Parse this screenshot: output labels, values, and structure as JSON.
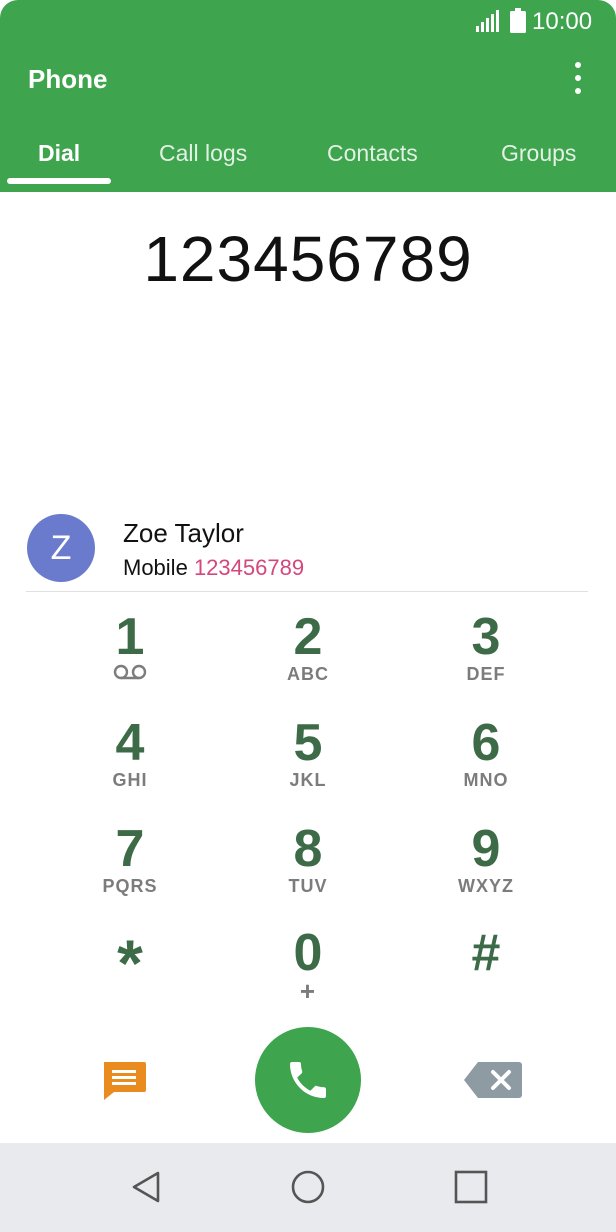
{
  "status_bar": {
    "time": "10:00",
    "signal_icon": "signal-icon",
    "battery_icon": "battery-icon"
  },
  "app": {
    "title": "Phone",
    "menu_icon": "overflow-menu-icon"
  },
  "tabs": [
    {
      "label": "Dial",
      "active": true
    },
    {
      "label": "Call logs",
      "active": false
    },
    {
      "label": "Contacts",
      "active": false
    },
    {
      "label": "Groups",
      "active": false
    }
  ],
  "dialed_number": "123456789",
  "suggestion": {
    "avatar_initial": "Z",
    "name": "Zoe Taylor",
    "type": "Mobile",
    "number": "123456789"
  },
  "keypad": [
    {
      "digit": "1",
      "letters": "",
      "sub_icon": "voicemail-icon"
    },
    {
      "digit": "2",
      "letters": "ABC"
    },
    {
      "digit": "3",
      "letters": "DEF"
    },
    {
      "digit": "4",
      "letters": "GHI"
    },
    {
      "digit": "5",
      "letters": "JKL"
    },
    {
      "digit": "6",
      "letters": "MNO"
    },
    {
      "digit": "7",
      "letters": "PQRS"
    },
    {
      "digit": "8",
      "letters": "TUV"
    },
    {
      "digit": "9",
      "letters": "WXYZ"
    },
    {
      "digit": "*",
      "letters": ""
    },
    {
      "digit": "0",
      "letters": "+"
    },
    {
      "digit": "#",
      "letters": ""
    }
  ],
  "actions": {
    "message_icon": "message-icon",
    "call_icon": "call-icon",
    "backspace_icon": "backspace-icon"
  },
  "navbar": {
    "back_icon": "back-icon",
    "home_icon": "home-icon",
    "recents_icon": "recents-icon"
  },
  "colors": {
    "primary": "#3ea44e",
    "key_digit": "#3d6a47",
    "avatar": "#6a7bcd",
    "number_highlight": "#d4477a",
    "message_icon": "#ea8b1f",
    "backspace_icon": "#8e9ba2",
    "navbar_bg": "#e8eaed"
  }
}
